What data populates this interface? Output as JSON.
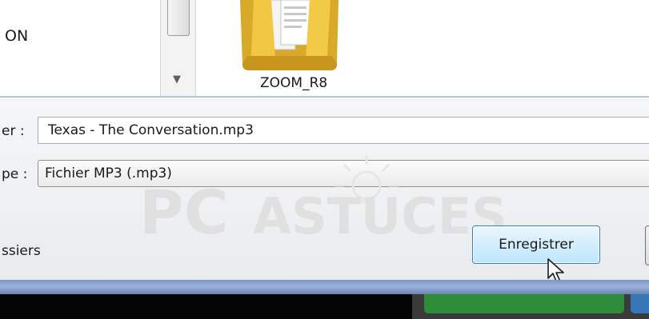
{
  "nav_pane": {
    "partial_item": "ON"
  },
  "folder": {
    "label": "ZOOM_R8",
    "icon": "folder-icon"
  },
  "form": {
    "filename_label": "er :",
    "filename_value": "Texas - The Conversation.mp3",
    "filetype_label": "pe :",
    "filetype_value": "Fichier MP3 (.mp3)"
  },
  "footer": {
    "hide_folders_label": "ssiers",
    "save_label": "Enregistrer"
  },
  "watermark": {
    "left": "PC",
    "right": "ASTUCES"
  },
  "colors": {
    "accent": "#3c7fb1",
    "frame": "#7b95c5",
    "green": "#2e8b3a"
  }
}
